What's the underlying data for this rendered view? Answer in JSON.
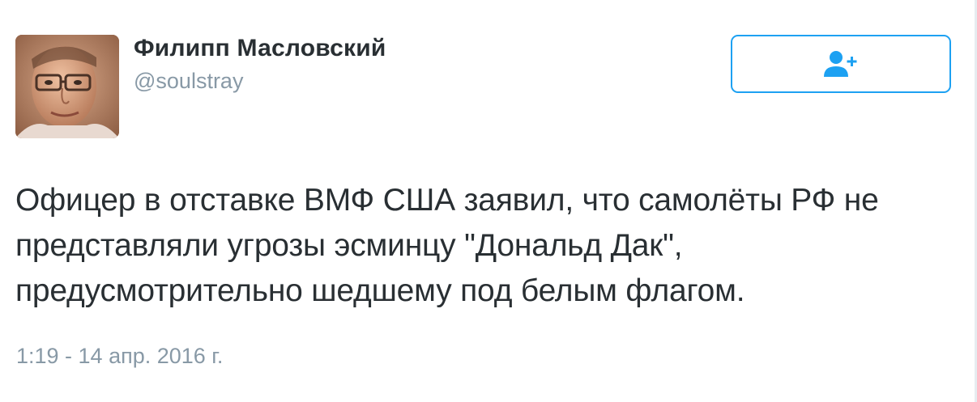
{
  "author": {
    "display_name": "Филипп Масловский",
    "handle": "@soulstray",
    "avatar_icon": "user-photo"
  },
  "follow_button": {
    "icon": "add-user-icon",
    "color": "#1da1f2"
  },
  "tweet": {
    "lines": [
      "Офицер в отставке ВМФ США заявил, что самолёты РФ не",
      "представляли угрозы эсминцу \"Дональд Дак\",",
      "предусмотрительно шедшему под белым флагом."
    ],
    "timestamp": "1:19 - 14 апр. 2016 г."
  },
  "colors": {
    "text": "#292f33",
    "muted": "#8899a6",
    "accent": "#1da1f2"
  }
}
